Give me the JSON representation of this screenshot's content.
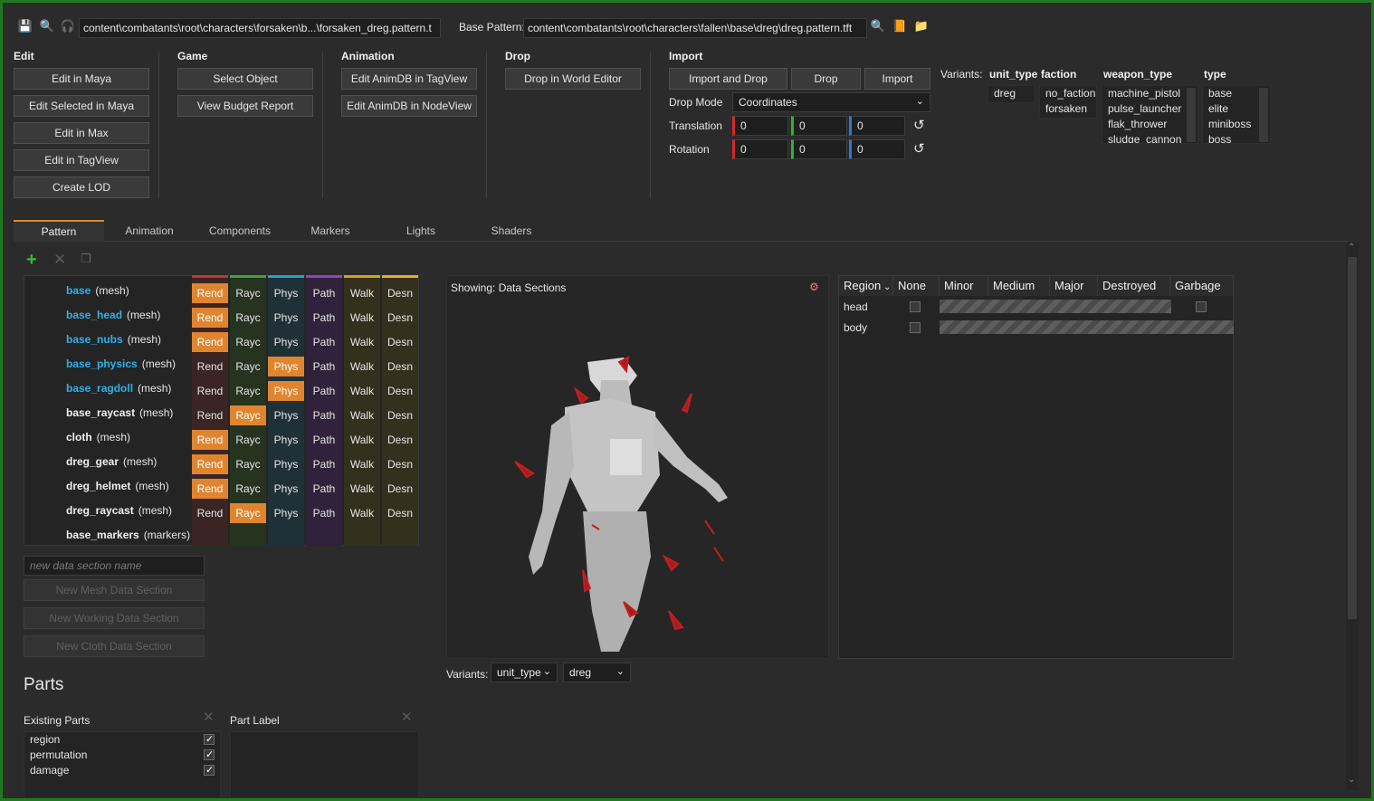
{
  "toolbar": {
    "pattern_path": "content\\combatants\\root\\characters\\forsaken\\b...\\forsaken_dreg.pattern.t",
    "base_pattern_label": "Base Pattern:",
    "base_pattern_path": "content\\combatants\\root\\characters\\fallen\\base\\dreg\\dreg.pattern.tft"
  },
  "groups": {
    "edit": {
      "title": "Edit",
      "buttons": [
        "Edit in Maya",
        "Edit Selected in Maya",
        "Edit in Max",
        "Edit in TagView",
        "Create LOD"
      ]
    },
    "game": {
      "title": "Game",
      "buttons": [
        "Select Object",
        "View Budget Report"
      ]
    },
    "animation": {
      "title": "Animation",
      "buttons": [
        "Edit AnimDB in TagView",
        "Edit AnimDB in NodeView"
      ]
    },
    "drop": {
      "title": "Drop",
      "buttons": [
        "Drop in World Editor"
      ]
    },
    "import": {
      "title": "Import",
      "buttons": [
        "Import and Drop",
        "Drop",
        "Import"
      ],
      "drop_mode_label": "Drop Mode",
      "drop_mode_value": "Coordinates",
      "translation_label": "Translation",
      "rotation_label": "Rotation",
      "translation": [
        "0",
        "0",
        "0"
      ],
      "rotation": [
        "0",
        "0",
        "0"
      ]
    }
  },
  "variants": {
    "label": "Variants:",
    "columns": [
      {
        "header": "unit_type",
        "items": [
          "dreg"
        ]
      },
      {
        "header": "faction",
        "items": [
          "no_faction",
          "forsaken"
        ]
      },
      {
        "header": "weapon_type",
        "items": [
          "machine_pistol",
          "pulse_launcher",
          "flak_thrower",
          "sludge_cannon"
        ]
      },
      {
        "header": "type",
        "items": [
          "base",
          "elite",
          "miniboss",
          "boss"
        ]
      }
    ]
  },
  "tabs": [
    "Pattern",
    "Animation",
    "Components",
    "Markers",
    "Lights",
    "Shaders"
  ],
  "sections": [
    {
      "name": "base",
      "kind": "(mesh)",
      "style": "hl",
      "flags": [
        "Rend",
        "Rayc",
        "Phys",
        "Path",
        "Walk",
        "Desn"
      ],
      "on": [
        0
      ]
    },
    {
      "name": "base_head",
      "kind": "(mesh)",
      "style": "hl",
      "flags": [
        "Rend",
        "Rayc",
        "Phys",
        "Path",
        "Walk",
        "Desn"
      ],
      "on": [
        0
      ]
    },
    {
      "name": "base_nubs",
      "kind": "(mesh)",
      "style": "hl",
      "flags": [
        "Rend",
        "Rayc",
        "Phys",
        "Path",
        "Walk",
        "Desn"
      ],
      "on": [
        0
      ]
    },
    {
      "name": "base_physics",
      "kind": "(mesh)",
      "style": "hl",
      "flags": [
        "Rend",
        "Rayc",
        "Phys",
        "Path",
        "Walk",
        "Desn"
      ],
      "on": [
        2
      ]
    },
    {
      "name": "base_ragdoll",
      "kind": "(mesh)",
      "style": "hl",
      "flags": [
        "Rend",
        "Rayc",
        "Phys",
        "Path",
        "Walk",
        "Desn"
      ],
      "on": [
        2
      ]
    },
    {
      "name": "base_raycast",
      "kind": "(mesh)",
      "style": "b",
      "flags": [
        "Rend",
        "Rayc",
        "Phys",
        "Path",
        "Walk",
        "Desn"
      ],
      "on": [
        1
      ]
    },
    {
      "name": "cloth",
      "kind": "(mesh)",
      "style": "b",
      "flags": [
        "Rend",
        "Rayc",
        "Phys",
        "Path",
        "Walk",
        "Desn"
      ],
      "on": [
        0
      ]
    },
    {
      "name": "dreg_gear",
      "kind": "(mesh)",
      "style": "b",
      "flags": [
        "Rend",
        "Rayc",
        "Phys",
        "Path",
        "Walk",
        "Desn"
      ],
      "on": [
        0
      ]
    },
    {
      "name": "dreg_helmet",
      "kind": "(mesh)",
      "style": "b",
      "flags": [
        "Rend",
        "Rayc",
        "Phys",
        "Path",
        "Walk",
        "Desn"
      ],
      "on": [
        0
      ]
    },
    {
      "name": "dreg_raycast",
      "kind": "(mesh)",
      "style": "b",
      "flags": [
        "Rend",
        "Rayc",
        "Phys",
        "Path",
        "Walk",
        "Desn"
      ],
      "on": [
        1
      ]
    },
    {
      "name": "base_markers",
      "kind": "(markers)",
      "style": "b",
      "flags": [],
      "on": []
    }
  ],
  "new_section": {
    "placeholder": "new data section name",
    "buttons": [
      "New Mesh Data Section",
      "New Working Data Section",
      "New Cloth Data Section"
    ]
  },
  "viewport": {
    "showing": "Showing: Data Sections",
    "variants_label": "Variants:",
    "variant_key": "unit_type",
    "variant_value": "dreg"
  },
  "regions": {
    "headers": [
      "Region",
      "None",
      "Minor",
      "Medium",
      "Major",
      "Destroyed",
      "Garbage"
    ],
    "rows": [
      "head",
      "body"
    ]
  },
  "parts": {
    "title": "Parts",
    "existing_label": "Existing Parts",
    "part_label": "Part Label",
    "items": [
      "region",
      "permutation",
      "damage"
    ]
  },
  "colors": {
    "rend": "#c0392b",
    "rayc": "#3aa63a",
    "phys": "#2a9fd0",
    "path": "#9b3fc0",
    "walk": "#d4a51a",
    "desn": "#e0b21e",
    "accent": "#e0852f"
  }
}
